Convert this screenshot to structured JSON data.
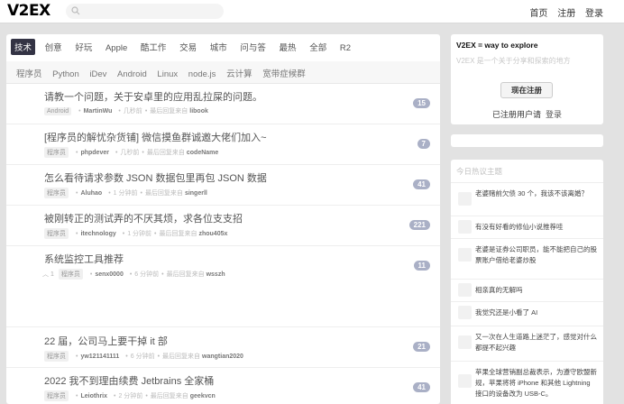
{
  "header": {
    "logo": "V2EX",
    "nav": [
      "首页",
      "注册",
      "登录"
    ]
  },
  "tabs": [
    "技术",
    "创意",
    "好玩",
    "Apple",
    "酷工作",
    "交易",
    "城市",
    "问与答",
    "最热",
    "全部",
    "R2"
  ],
  "subtabs": [
    "程序员",
    "Python",
    "iDev",
    "Android",
    "Linux",
    "node.js",
    "云计算",
    "宽带症候群"
  ],
  "topics": [
    {
      "title": "请教一个问题，关于安卓里的应用乱拉屎的问题。",
      "node": "Android",
      "author": "MartinWu",
      "time": "几秒前",
      "last_reply_label": "最后回复来自",
      "last_reply": "libook",
      "replies": "15"
    },
    {
      "title": "[程序员的解忧杂货铺] 微信摸鱼群诚邀大佬们加入~",
      "node": "程序员",
      "author": "phpdever",
      "time": "几秒前",
      "last_reply_label": "最后回复来自",
      "last_reply": "codeName",
      "replies": "7"
    },
    {
      "title": "怎么看待请求参数 JSON 数据包里再包 JSON 数据",
      "node": "程序员",
      "author": "Aluhao",
      "time": "1 分钟前",
      "last_reply_label": "最后回复来自",
      "last_reply": "singerll",
      "replies": "41"
    },
    {
      "title": "被刚转正的测试弄的不厌其烦，求各位支支招",
      "node": "程序员",
      "author": "itechnology",
      "time": "1 分钟前",
      "last_reply_label": "最后回复来自",
      "last_reply": "zhou405x",
      "replies": "221"
    },
    {
      "title": "系统监控工具推荐",
      "vote": "1",
      "node": "程序员",
      "author": "senx0000",
      "time": "6 分钟前",
      "last_reply_label": "最后回复来自",
      "last_reply": "wsszh",
      "replies": "11"
    },
    {
      "title": "22 届，公司马上要干掉 it 部",
      "node": "程序员",
      "author": "yw121141111",
      "time": "6 分钟前",
      "last_reply_label": "最后回复来自",
      "last_reply": "wangtian2020",
      "replies": "21"
    },
    {
      "title": "2022 我不到理由续费 Jetbrains 全家桶",
      "node": "程序员",
      "author": "Leiothrix",
      "time": "2 分钟前",
      "last_reply_label": "最后回复来自",
      "last_reply": "geekvcn",
      "replies": "41"
    }
  ],
  "sidebar": {
    "slogan": "V2EX = way to explore",
    "intro": "V2EX 是一个关于分享和探索的地方",
    "register": "现在注册",
    "registered_text": "已注册用户请",
    "login": "登录",
    "hot_title": "今日热议主题",
    "hot": [
      "老婆赌前欠债 30 个，我该不该离婚？",
      "有没有好看的修仙小说推荐哇",
      "老婆是证券公司职员，能不能把自己的股票账户借给老婆炒股",
      "相亲真的无解吗",
      "我觉究还是小看了 AI",
      "又一次在人生道路上迷茫了，感觉对什么都提不起兴趣",
      "苹果全球营销副总裁表示，为遵守欧盟新规，苹果将将 iPhone 和其他 Lightning 接口的设备改为 USB-C。"
    ]
  }
}
